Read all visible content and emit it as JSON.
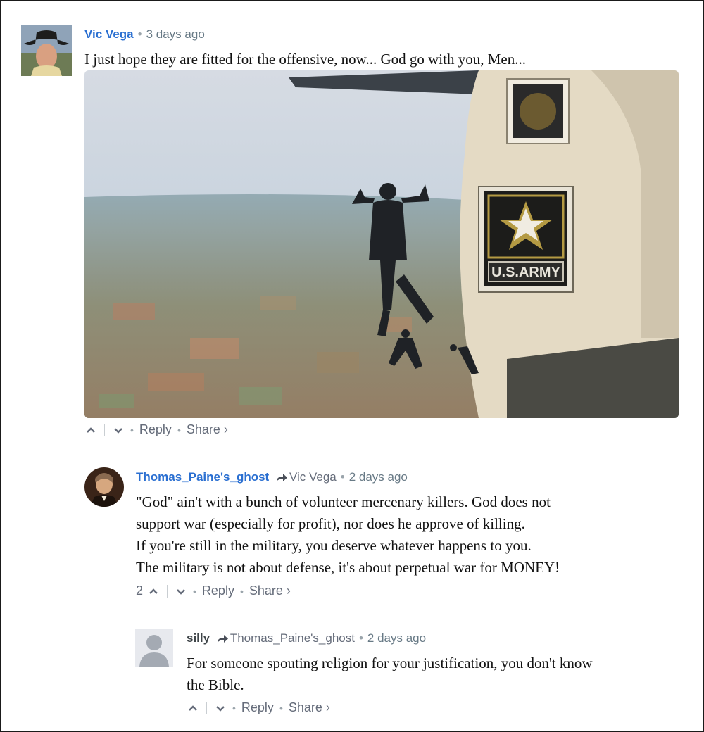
{
  "comments": [
    {
      "author": "Vic Vega",
      "time": "3 days ago",
      "text": [
        "I just hope they are fitted for the offensive, now... God go with you, Men..."
      ],
      "actions": {
        "reply": "Reply",
        "share": "Share ›"
      },
      "image": {
        "label": "U.S.ARMY"
      }
    },
    {
      "author": "Thomas_Paine's_ghost",
      "reply_to": "Vic Vega",
      "time": "2 days ago",
      "text": [
        "\"God\" ain't with a bunch of volunteer mercenary killers. God does not",
        "support war (especially for profit), nor does he approve of killing.",
        "If you're still in the military, you deserve whatever happens to you.",
        "The military is not about defense, it's about perpetual war for MONEY!"
      ],
      "upvotes": "2",
      "actions": {
        "reply": "Reply",
        "share": "Share ›"
      }
    },
    {
      "author": "silly",
      "reply_to": "Thomas_Paine's_ghost",
      "time": "2 days ago",
      "text": [
        "For someone spouting religion for your justification, you don't know",
        "the Bible."
      ],
      "actions": {
        "reply": "Reply",
        "share": "Share ›"
      }
    }
  ],
  "colors": {
    "link": "#2a6fd1",
    "meta": "#656c7a"
  },
  "icons": [
    "upvote-icon",
    "downvote-icon",
    "reply-arrow-icon",
    "default-avatar-icon"
  ]
}
